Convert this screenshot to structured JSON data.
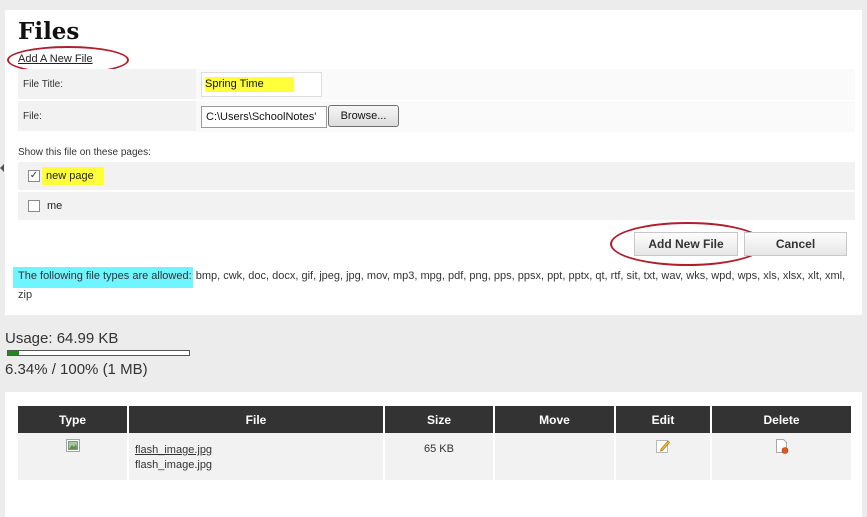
{
  "page": {
    "title": "Files",
    "add_link": "Add A New File"
  },
  "form": {
    "title_label": "File Title:",
    "title_value": "Spring Time",
    "file_label": "File:",
    "file_value": "C:\\Users\\SchoolNotes'",
    "browse_label": "Browse...",
    "show_label": "Show this file on these pages:",
    "pages": [
      {
        "label": "new page",
        "checked": true
      },
      {
        "label": "me",
        "checked": false
      }
    ],
    "add_button": "Add New File",
    "cancel_button": "Cancel",
    "allowed_prefix": "The following file types are allowed:",
    "allowed_types": " bmp, cwk, doc, docx, gif, jpeg, jpg, mov, mp3, mpg, pdf, png, pps, ppsx, ppt, pptx, qt, rtf, sit, txt, wav, wks, wpd, wps, xls, xlsx, xlt, xml, zip"
  },
  "usage": {
    "label": "Usage: 64.99 KB",
    "percent_text": "6.34% / 100% (1 MB)",
    "fraction": 0.0634
  },
  "table": {
    "headers": [
      "Type",
      "File",
      "Size",
      "Move",
      "Edit",
      "Delete"
    ],
    "rows": [
      {
        "file_link": "flash_image.jpg",
        "file_name": "flash_image.jpg",
        "size": "65 KB"
      }
    ]
  },
  "icons": {
    "type": "image-file-icon",
    "edit": "pencil-edit-icon",
    "delete": "delete-file-icon"
  },
  "colors": {
    "yellow_highlight": "#ffff3a",
    "cyan_highlight": "#6ff5ff",
    "annotation_ring": "#b01e2b",
    "usage_fill": "#1a8c1a",
    "table_header": "#333333"
  }
}
